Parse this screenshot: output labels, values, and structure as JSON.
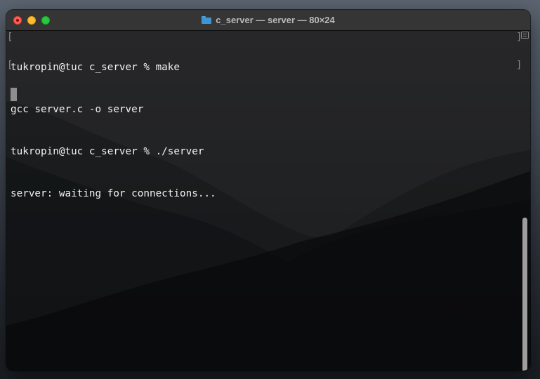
{
  "window": {
    "title": "c_server — server — 80×24",
    "title_icon": "folder-icon"
  },
  "terminal": {
    "lines": [
      "tukropin@tuc c_server % make",
      "gcc server.c -o server",
      "tukropin@tuc c_server % ./server",
      "server: waiting for connections..."
    ],
    "bracket_left": "[",
    "bracket_right": "]"
  },
  "colors": {
    "close": "#ff5f57",
    "minimize": "#febc2e",
    "zoom": "#28c840",
    "text": "#f2f2f2"
  }
}
